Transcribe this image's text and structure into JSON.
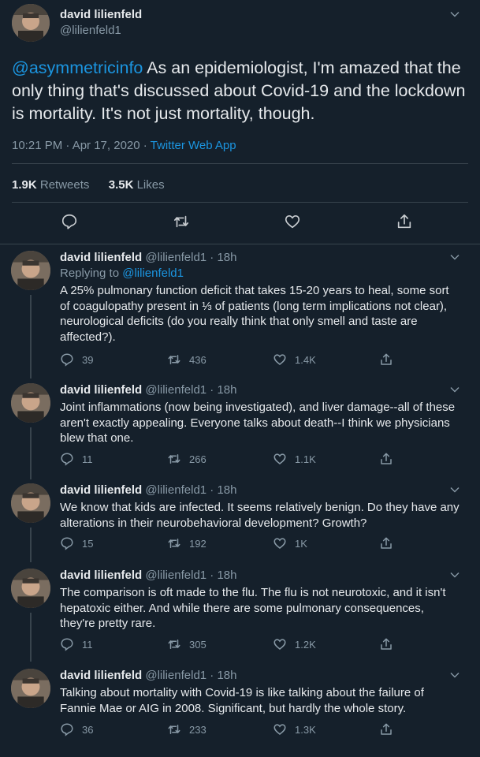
{
  "main_tweet": {
    "author_name": "david lilienfeld",
    "author_handle": "@lilienfeld1",
    "mention": "@asymmetricinfo",
    "body": " As an epidemiologist, I'm amazed that the only thing that's discussed about Covid-19 and the lockdown is mortality. It's not just mortality, though.",
    "timestamp": "10:21 PM · Apr 17, 2020 · ",
    "source": "Twitter Web App",
    "retweets_count": "1.9K",
    "retweets_label": "Retweets",
    "likes_count": "3.5K",
    "likes_label": "Likes"
  },
  "icons": {
    "reply": "reply-icon",
    "retweet": "retweet-icon",
    "like": "heart-icon",
    "share": "share-icon",
    "menu": "chevron-down-icon"
  },
  "colors": {
    "background": "#15202b",
    "link": "#1b95e0",
    "muted": "#8899a6",
    "divider": "#38444d"
  },
  "replies": [
    {
      "name": "david lilienfeld",
      "meta": "@lilienfeld1 · 18h",
      "replying_label": "Replying to ",
      "replying_handle": "@lilienfeld1",
      "text": "A 25% pulmonary function deficit that takes 15-20 years to heal, some sort of coagulopathy present in ⅓ of patients (long term implications not clear), neurological deficits (do you really think that only smell and taste are affected?).",
      "replies": "39",
      "retweets": "436",
      "likes": "1.4K"
    },
    {
      "name": "david lilienfeld",
      "meta": "@lilienfeld1 · 18h",
      "text": "Joint inflammations (now being investigated), and liver damage--all of these aren't exactly appealing. Everyone talks about death--I think we physicians blew that one.",
      "replies": "11",
      "retweets": "266",
      "likes": "1.1K"
    },
    {
      "name": "david lilienfeld",
      "meta": "@lilienfeld1 · 18h",
      "text": "We know that kids are infected. It seems relatively benign. Do they have any alterations in their neurobehavioral development? Growth?",
      "replies": "15",
      "retweets": "192",
      "likes": "1K"
    },
    {
      "name": "david lilienfeld",
      "meta": "@lilienfeld1 · 18h",
      "text": "The comparison is oft made to the flu. The flu is not neurotoxic, and it isn't hepatoxic either. And while there are some pulmonary consequences, they're pretty rare.",
      "replies": "11",
      "retweets": "305",
      "likes": "1.2K"
    },
    {
      "name": "david lilienfeld",
      "meta": "@lilienfeld1 · 18h",
      "text": "Talking about mortality with Covid-19 is like talking about the failure of Fannie Mae or AIG in 2008. Significant, but hardly the whole story.",
      "replies": "36",
      "retweets": "233",
      "likes": "1.3K"
    }
  ]
}
